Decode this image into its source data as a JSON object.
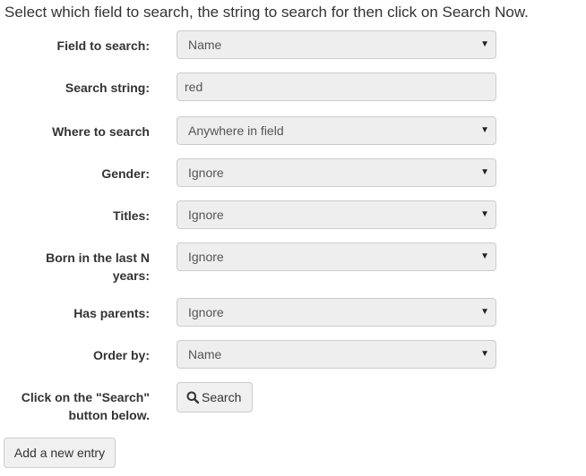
{
  "intro_text": "Select which field to search, the string to search for then click on Search Now.",
  "fields": {
    "field_to_search": {
      "label": "Field to search:",
      "value": "Name"
    },
    "search_string": {
      "label": "Search string:",
      "value": "red"
    },
    "where_to_search": {
      "label": "Where to search",
      "value": "Anywhere in field"
    },
    "gender": {
      "label": "Gender:",
      "value": "Ignore"
    },
    "titles": {
      "label": "Titles:",
      "value": "Ignore"
    },
    "born_in_last_n_years": {
      "label_line1": "Born in the last N",
      "label_line2": "years:",
      "value": "Ignore"
    },
    "has_parents": {
      "label": "Has parents:",
      "value": "Ignore"
    },
    "order_by": {
      "label": "Order by:",
      "value": "Name"
    }
  },
  "search_hint": {
    "line1": "Click on the \"Search\"",
    "line2": "button below."
  },
  "buttons": {
    "search_label": "Search",
    "add_entry_label": "Add a new entry"
  },
  "icons": {
    "dropdown": "caret-down-icon",
    "search": "magnifier-icon"
  },
  "caret_glyph": "▼"
}
